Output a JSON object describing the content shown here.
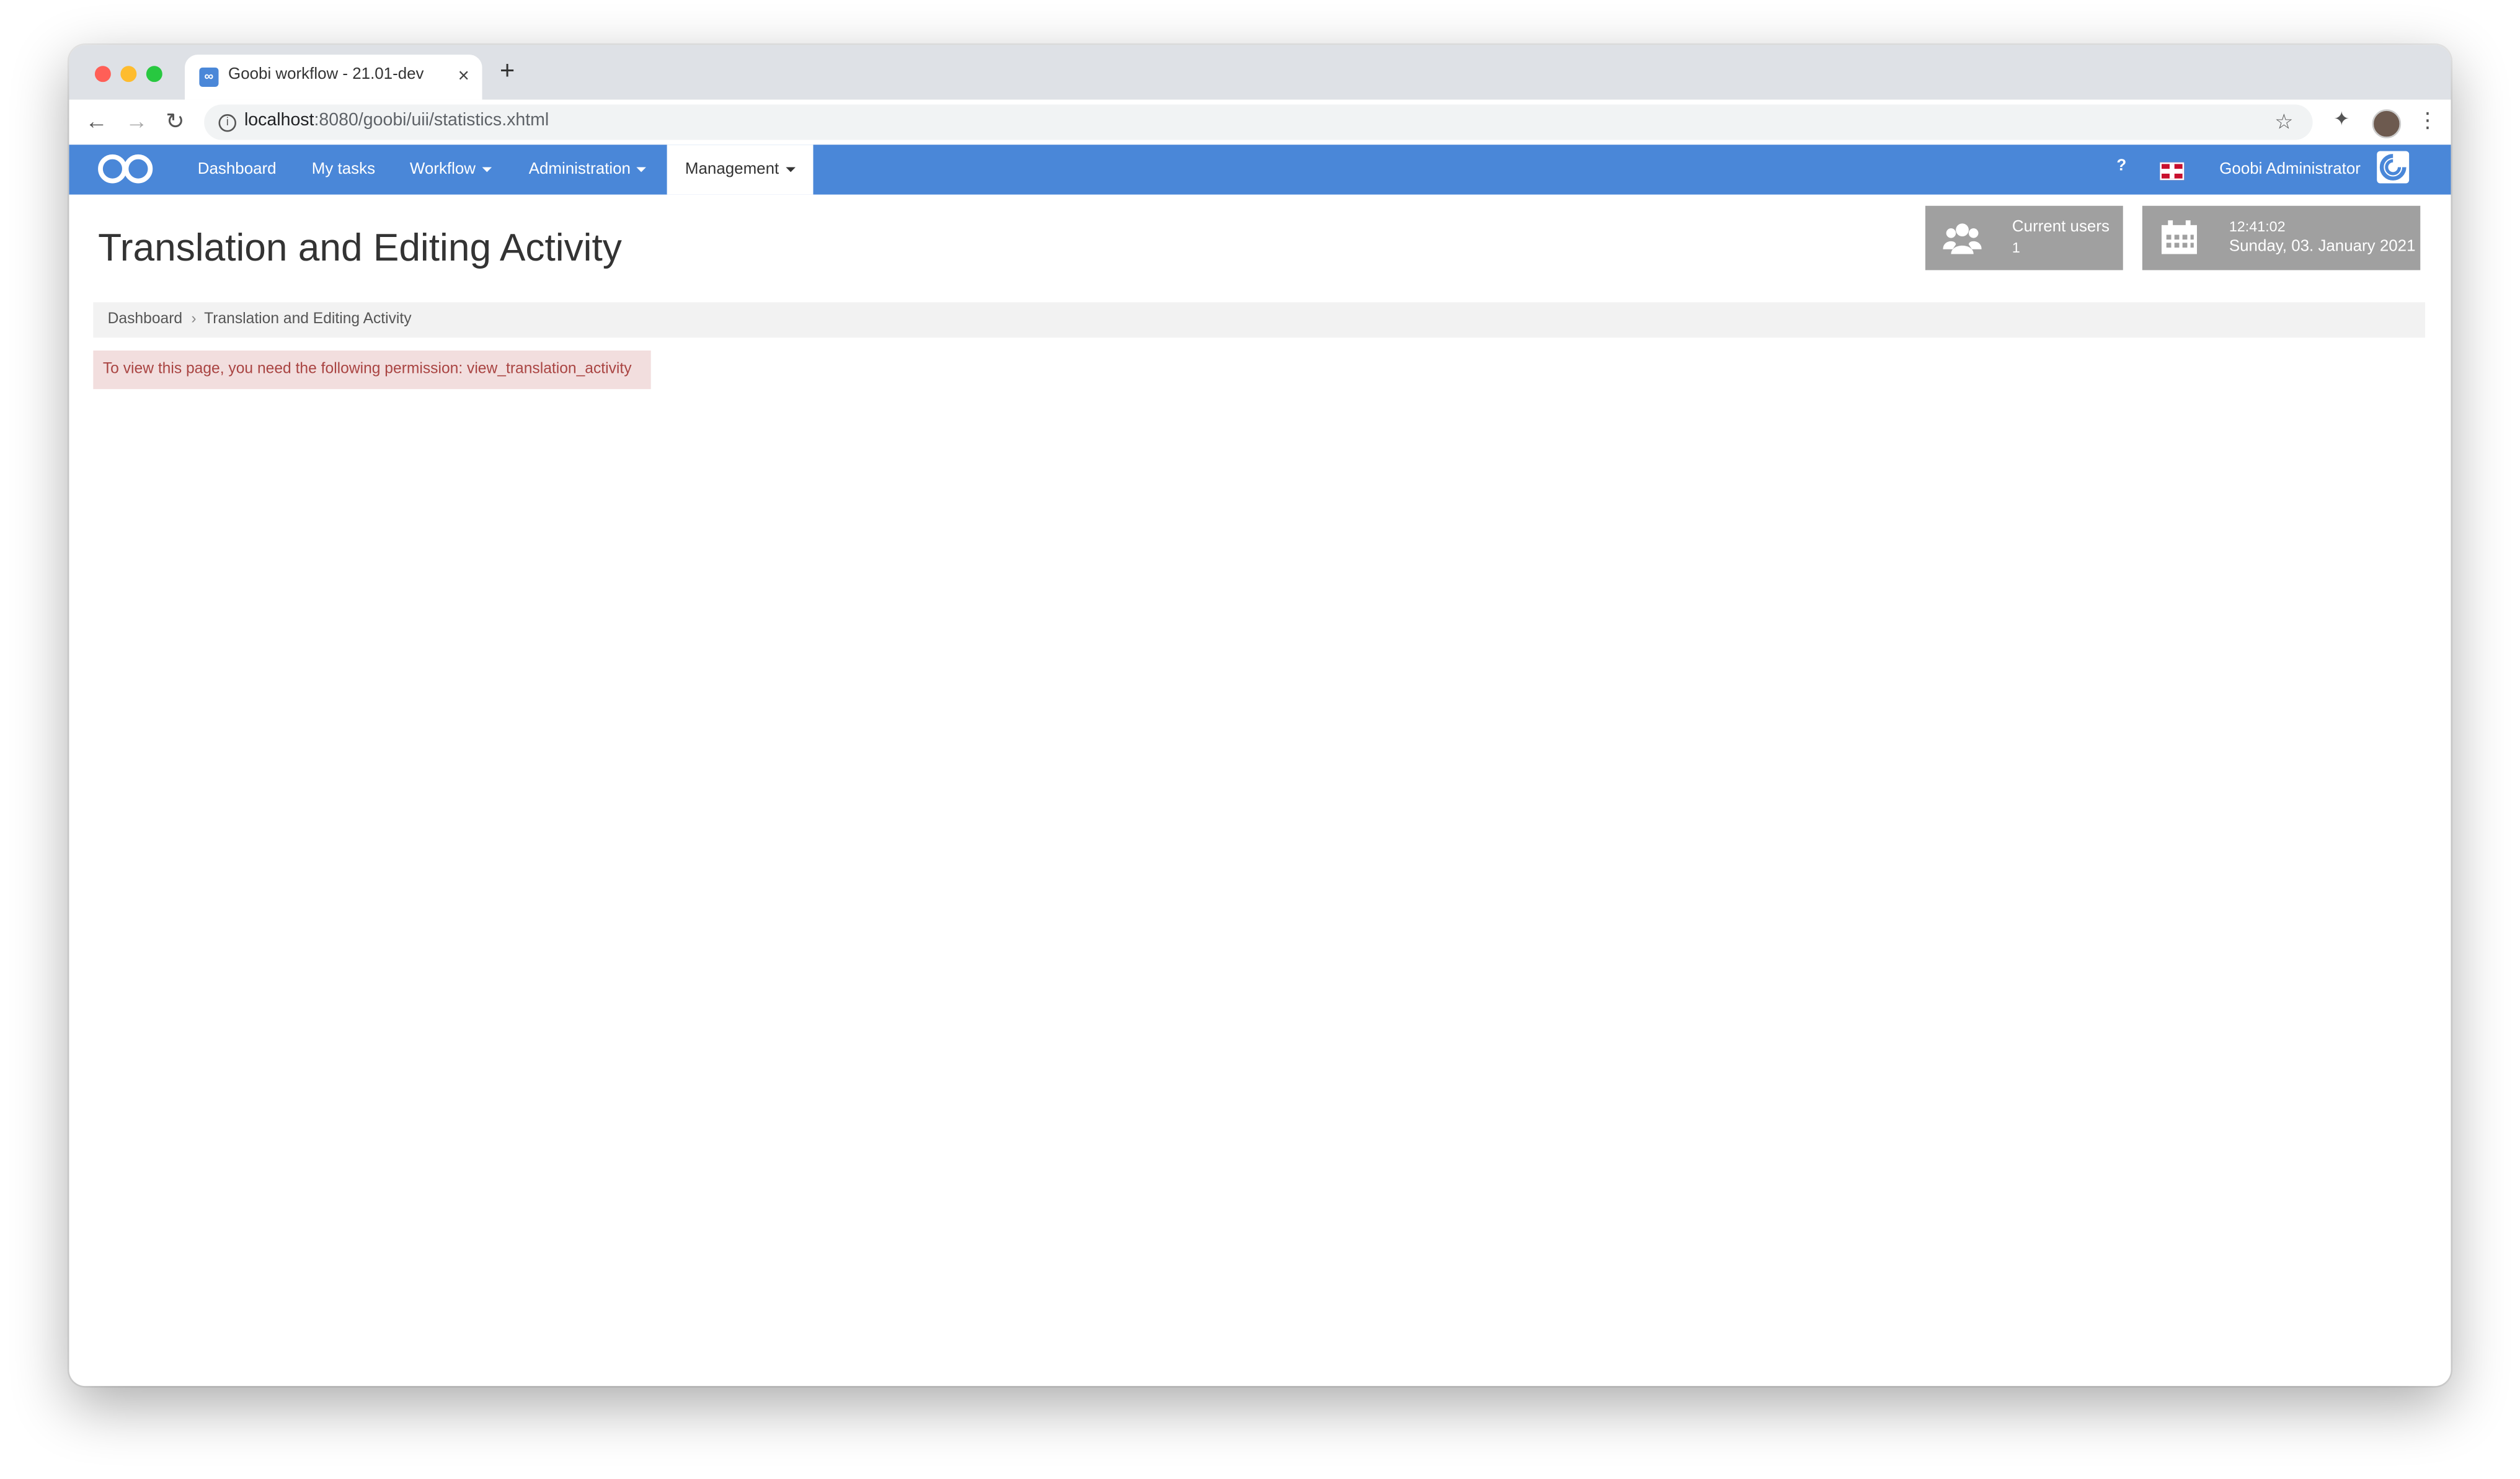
{
  "browser": {
    "tab_title": "Goobi workflow - 21.01-dev",
    "tab_close": "×",
    "new_tab": "+",
    "url_host": "localhost",
    "url_rest": ":8080/goobi/uii/statistics.xhtml",
    "back": "←",
    "forward": "→",
    "reload": "↻",
    "star": "☆",
    "menu": "⋮",
    "extensions": "✦",
    "info": "i"
  },
  "navbar": {
    "items": [
      {
        "label": "Dashboard"
      },
      {
        "label": "My tasks"
      },
      {
        "label": "Workflow"
      },
      {
        "label": "Administration"
      },
      {
        "label": "Management"
      }
    ],
    "active": "Management",
    "help": "?",
    "user_name": "Goobi Administrator"
  },
  "page": {
    "title": "Translation and Editing Activity",
    "breadcrumb": {
      "home": "Dashboard",
      "separator": "›",
      "current": "Translation and Editing Activity"
    },
    "alert": "To view this page, you need the following permission: view_translation_activity"
  },
  "widgets": {
    "users": {
      "label": "Current users",
      "value": "1"
    },
    "clock": {
      "time": "12:41:02",
      "date": "Sunday, 03. January 2021"
    }
  },
  "colors": {
    "brand": "#4a87d8",
    "widget_bg": "#a0a0a0",
    "alert_bg": "#f2dede",
    "alert_text": "#a94442"
  }
}
